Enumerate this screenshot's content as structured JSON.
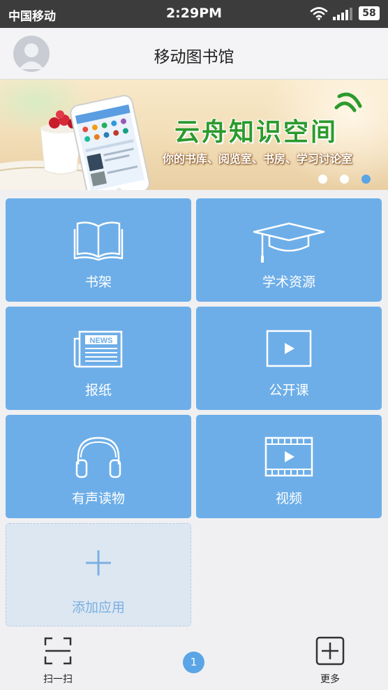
{
  "status_bar": {
    "carrier": "中国移动",
    "time": "2:29PM",
    "battery": "58"
  },
  "header": {
    "title": "移动图书馆"
  },
  "banner": {
    "headline": "云舟知识空间",
    "subline": "你的书库、阅览室、书房、学习讨论室",
    "active_dot": 3
  },
  "tiles": [
    {
      "label": "书架",
      "icon": "book-icon"
    },
    {
      "label": "学术资源",
      "icon": "graduation-cap-icon"
    },
    {
      "label": "报纸",
      "icon": "newspaper-icon"
    },
    {
      "label": "公开课",
      "icon": "play-icon"
    },
    {
      "label": "有声读物",
      "icon": "headphones-icon"
    },
    {
      "label": "视频",
      "icon": "film-icon"
    }
  ],
  "add_tile": {
    "label": "添加应用",
    "icon": "plus-icon"
  },
  "bottom_bar": {
    "scan_label": "扫一扫",
    "more_label": "更多",
    "badge_count": "1"
  },
  "colors": {
    "tile": "#6daee8",
    "status_bar": "#3c3c3c",
    "banner_green": "#2c9a2c"
  }
}
